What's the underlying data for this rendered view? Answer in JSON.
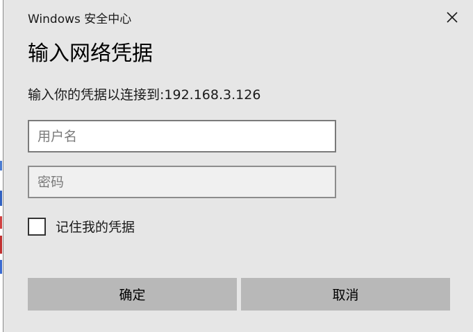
{
  "window": {
    "title": "Windows 安全中心",
    "close_icon": "close-icon"
  },
  "dialog": {
    "heading": "输入网络凭据",
    "subtitle": "输入你的凭据以连接到:192.168.3.126"
  },
  "fields": {
    "username_placeholder": "用户名",
    "username_value": "",
    "password_placeholder": "密码",
    "password_value": ""
  },
  "remember": {
    "label": "记住我的凭据",
    "checked": false
  },
  "buttons": {
    "ok_label": "确定",
    "cancel_label": "取消"
  },
  "colors": {
    "dialog_background": "#e6e6e6",
    "button_background": "#b8b8b8",
    "field_border": "#7a7a7a"
  }
}
